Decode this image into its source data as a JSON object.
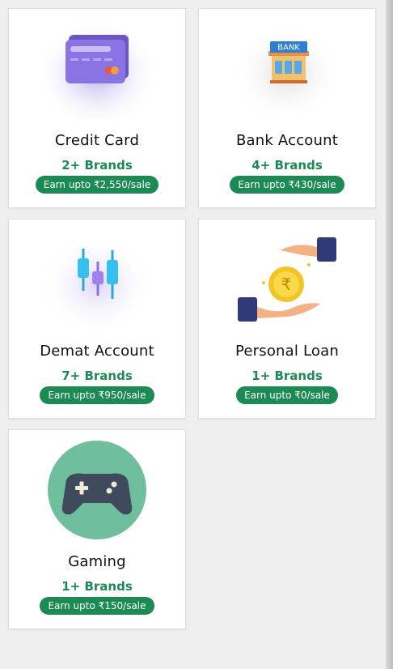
{
  "colors": {
    "accent_green": "#1b8a53",
    "brands_text": "#1d8a55",
    "page_bg": "#efefef",
    "card_bg": "#ffffff"
  },
  "cards": [
    {
      "title": "Credit Card",
      "brands": "2+ Brands",
      "earn": "Earn upto ₹2,550/sale",
      "icon": "credit-card-icon"
    },
    {
      "title": "Bank Account",
      "brands": "4+ Brands",
      "earn": "Earn upto ₹430/sale",
      "icon": "bank-icon",
      "icon_text": "BANK"
    },
    {
      "title": "Demat Account",
      "brands": "7+ Brands",
      "earn": "Earn upto ₹950/sale",
      "icon": "candlestick-chart-icon"
    },
    {
      "title": "Personal Loan",
      "brands": "1+ Brands",
      "earn": "Earn upto ₹0/sale",
      "icon": "rupee-coin-hands-icon",
      "icon_text": "₹"
    },
    {
      "title": "Gaming",
      "brands": "1+ Brands",
      "earn": "Earn upto ₹150/sale",
      "icon": "gamepad-icon"
    }
  ]
}
